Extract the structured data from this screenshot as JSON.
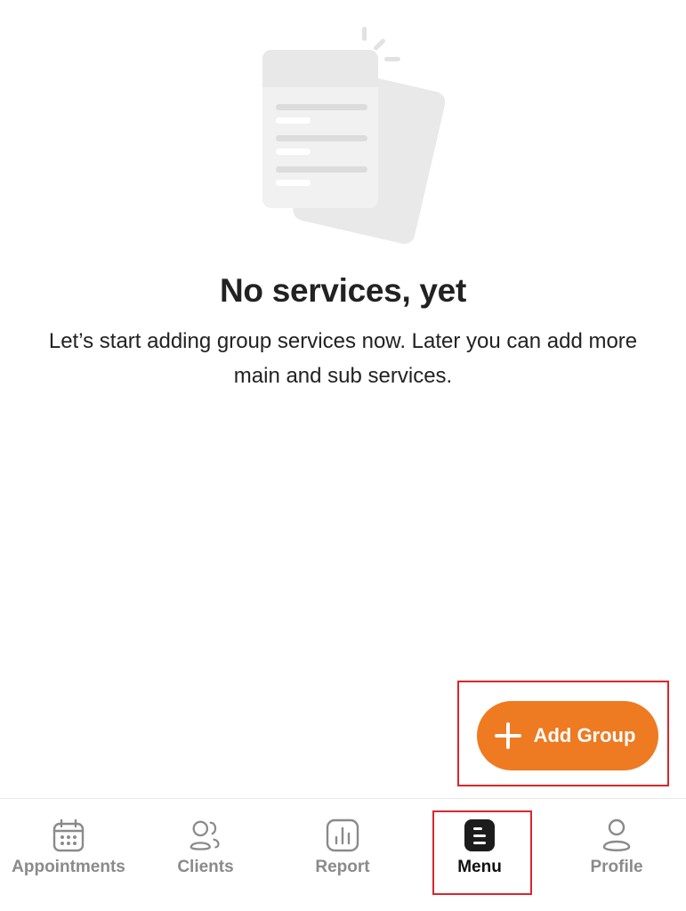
{
  "empty_state": {
    "title": "No services, yet",
    "description": "Let’s start adding group services now. Later you can add more main and sub services.",
    "illustration_icon": "documents-illustration"
  },
  "fab": {
    "label": "Add Group",
    "icon": "plus-icon",
    "color": "#EE7A22"
  },
  "bottom_nav": {
    "items": [
      {
        "label": "Appointments",
        "icon": "calendar-icon",
        "active": false
      },
      {
        "label": "Clients",
        "icon": "clients-icon",
        "active": false
      },
      {
        "label": "Report",
        "icon": "report-icon",
        "active": false
      },
      {
        "label": "Menu",
        "icon": "menu-icon",
        "active": true
      },
      {
        "label": "Profile",
        "icon": "profile-icon",
        "active": false
      }
    ]
  },
  "colors": {
    "accent": "#EE7A22",
    "highlight": "#D9262C",
    "inactive_nav": "#8A8A8A",
    "active_nav": "#111111"
  }
}
